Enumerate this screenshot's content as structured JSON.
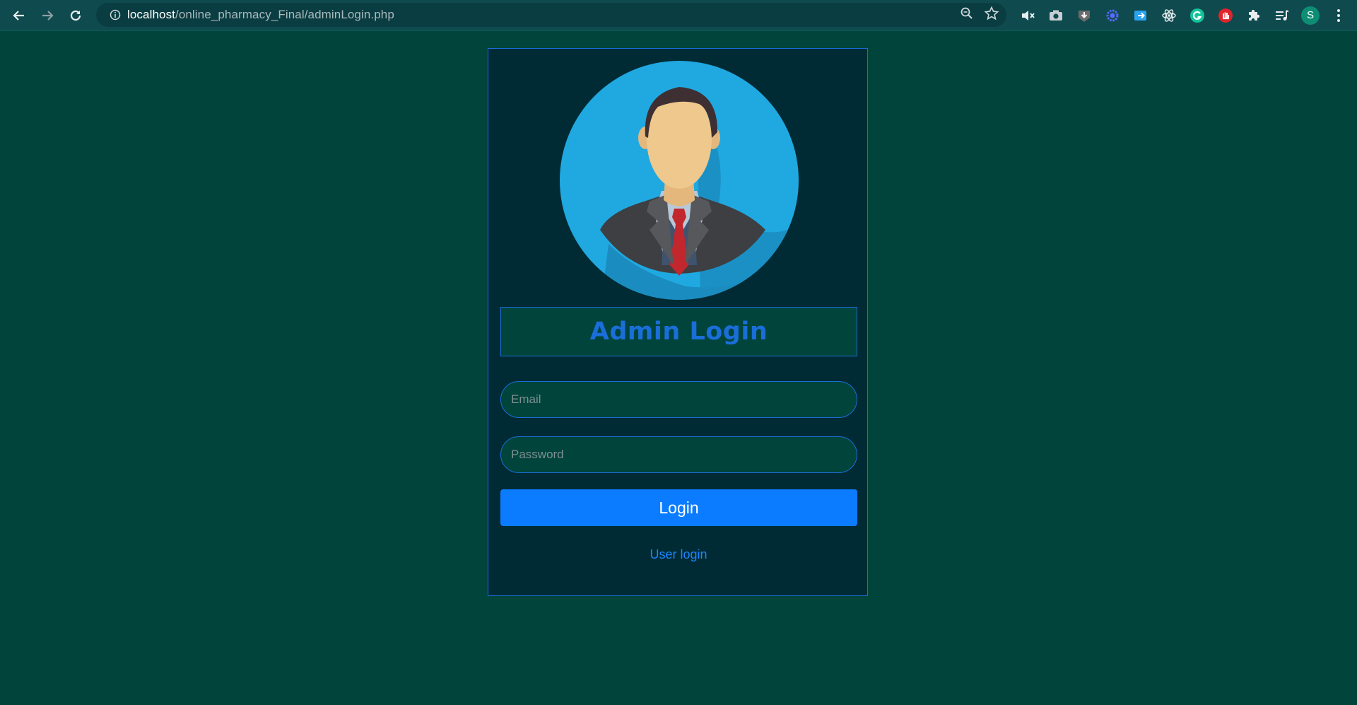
{
  "browser": {
    "url_host": "localhost",
    "url_path": "/online_pharmacy_Final/adminLogin.php",
    "profile_initial": "S",
    "icons": [
      "back-icon",
      "forward-icon",
      "reload-icon",
      "site-info-icon",
      "zoom-icon",
      "bookmark-star-icon",
      "mute-icon",
      "camera-icon",
      "download-icon",
      "extension-gear-icon",
      "send-tab-icon",
      "react-icon",
      "grammarly-icon",
      "adblock-hand-icon",
      "puzzle-extensions-icon",
      "media-control-icon",
      "profile-avatar",
      "menu-dots-icon"
    ]
  },
  "login": {
    "title": "Admin Login",
    "email_placeholder": "Email",
    "password_placeholder": "Password",
    "login_label": "Login",
    "user_login_link": "User login"
  },
  "colors": {
    "page_bg": "#00443b",
    "card_bg": "#002b35",
    "accent": "#1a6ed8",
    "button": "#0b7cff"
  }
}
